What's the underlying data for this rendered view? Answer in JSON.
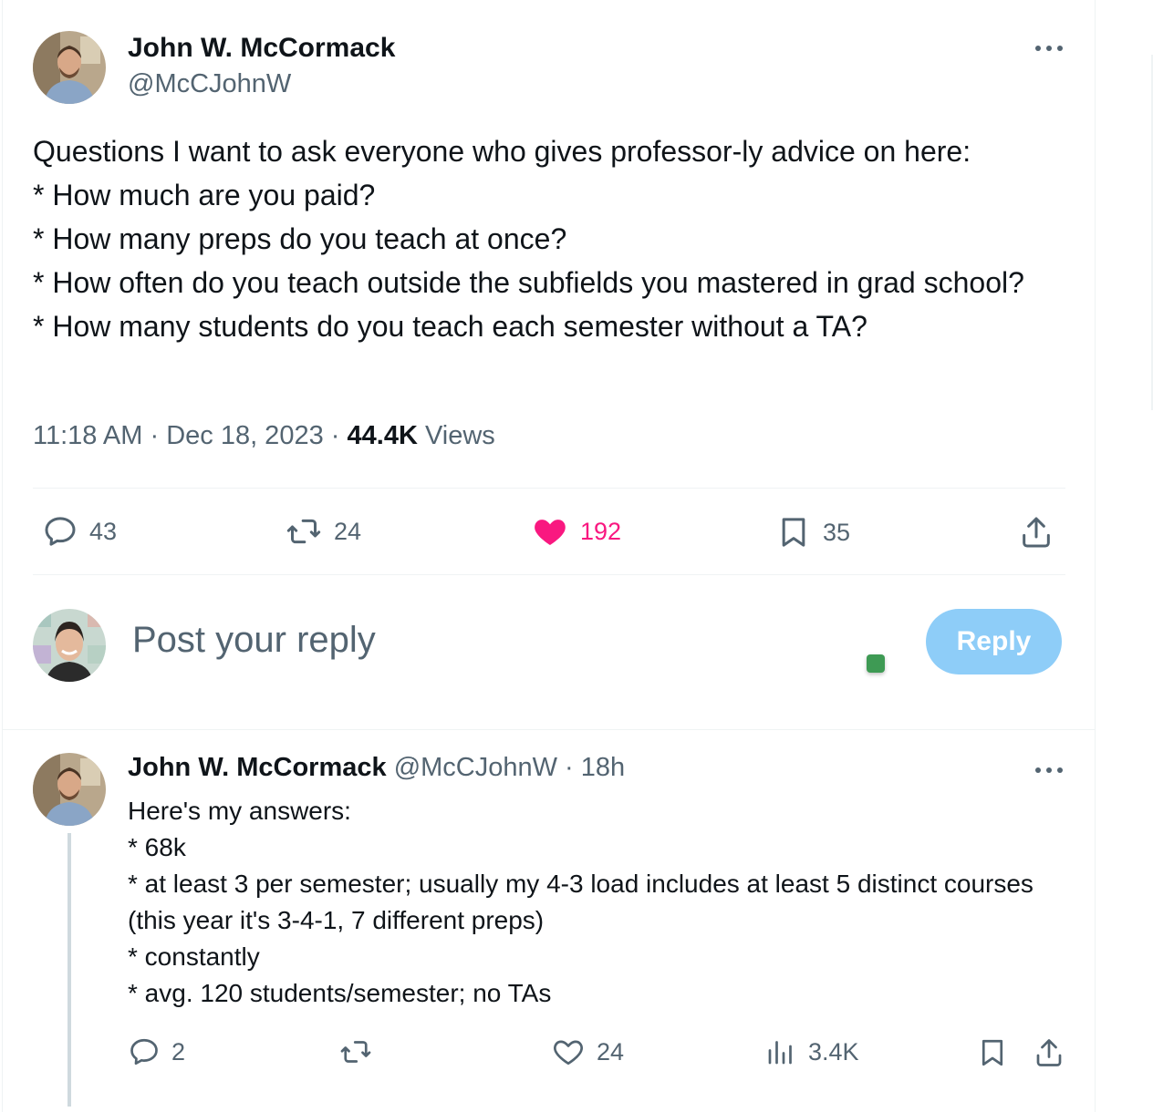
{
  "tweet": {
    "author_name": "John W. McCormack",
    "author_handle": "@McCJohnW",
    "avatar_icon": "profile-photo-man",
    "more_icon": "more-horizontal-icon",
    "text": "Questions I want to ask everyone who gives professor-ly advice on here:\n* How much are you paid?\n* How many preps do you teach at once?\n* How often do you teach outside the subfields you mastered in grad school?\n* How many students do you teach each semester without a TA?",
    "time": "11:18 AM",
    "date": "Dec 18, 2023",
    "views_count": "44.4K",
    "views_label": "Views",
    "separator": "·",
    "actions": {
      "replies": "43",
      "reposts": "24",
      "likes": "192",
      "bookmarks": "35"
    },
    "like_color": "#f91880"
  },
  "composer": {
    "placeholder": "Post your reply",
    "button_label": "Reply",
    "avatar_icon": "profile-photo-woman",
    "button_color": "#8ecdf8"
  },
  "reply": {
    "author_name": "John W. McCormack",
    "author_handle": "@McCJohnW",
    "age": "· 18h",
    "text": "Here's my answers:\n* 68k\n* at least 3 per semester; usually my 4-3 load includes at least 5 distinct courses (this year it's 3-4-1, 7 different preps)\n* constantly\n* avg. 120 students/semester; no TAs",
    "actions": {
      "replies": "2",
      "reposts": "",
      "likes": "24",
      "views": "3.4K"
    }
  }
}
